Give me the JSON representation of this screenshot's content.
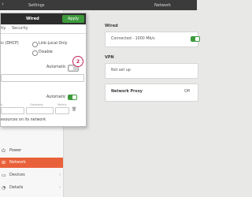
{
  "topbar": {
    "back_glyph": "‹",
    "settings_title": "Settings",
    "network_title": "Network"
  },
  "dialog": {
    "title": "Wired",
    "apply_label": "Apply",
    "tabs": [
      "ity",
      "Security"
    ],
    "dhcp_label": "ic (DHCP)",
    "link_local_label": "Link-Local Only",
    "disable_label": "Disable",
    "dns_automatic_label": "Automatic",
    "routes_automatic_label": "Automatic",
    "route_headers": [
      "k",
      "Gateway",
      "Metric"
    ],
    "only_resources_label": "esources on its network",
    "annotation_number": "2"
  },
  "sidebar": {
    "items": [
      {
        "label": "Power",
        "icon": "power-icon"
      },
      {
        "label": "Network",
        "icon": "network-icon",
        "active": true
      },
      {
        "label": "Devices",
        "icon": "devices-icon",
        "chevron": "›"
      },
      {
        "label": "Details",
        "icon": "details-icon",
        "chevron": "›"
      }
    ]
  },
  "main": {
    "wired": {
      "title": "Wired",
      "status": "Connected - 1000 Mb/s",
      "on": true
    },
    "vpn": {
      "title": "VPN",
      "status": "Not set up"
    },
    "proxy": {
      "title": "Network Proxy",
      "status": "Off"
    }
  },
  "colors": {
    "accent": "#e9613a",
    "toggle_on": "#3d9a3d",
    "annotation": "#c7255a",
    "topbar": "#3b3b3b"
  }
}
